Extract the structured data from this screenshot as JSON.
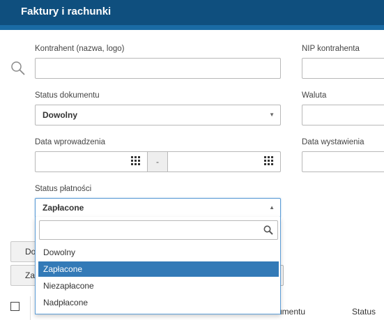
{
  "header": {
    "title": "Faktury i rachunki"
  },
  "form": {
    "contractor_label": "Kontrahent (nazwa, logo)",
    "nip_label": "NIP kontrahenta",
    "doc_status_label": "Status dokumentu",
    "doc_status_value": "Dowolny",
    "currency_label": "Waluta",
    "entry_date_label": "Data wprowadzenia",
    "date_separator": "-",
    "issue_date_label": "Data wystawienia",
    "payment_status_label": "Status płatności",
    "payment_status_value": "Zapłacone"
  },
  "dropdown": {
    "options": [
      "Dowolny",
      "Zapłacone",
      "Niezapłacone",
      "Nadpłacone"
    ],
    "selected_index": 1
  },
  "buttons": {
    "btn1_partial": "Do",
    "btn2_partial": "Za"
  },
  "table": {
    "col_document": "umentu",
    "col_status": "Status"
  },
  "icons": {
    "search": "search-icon",
    "calendar": "calendar-icon",
    "caret": "caret-down-icon"
  },
  "colors": {
    "header_bg": "#0f4f7e",
    "header_stripe": "#1a6ba4",
    "selected_option_bg": "#337ab7",
    "focus_border": "#5b9bd5"
  }
}
